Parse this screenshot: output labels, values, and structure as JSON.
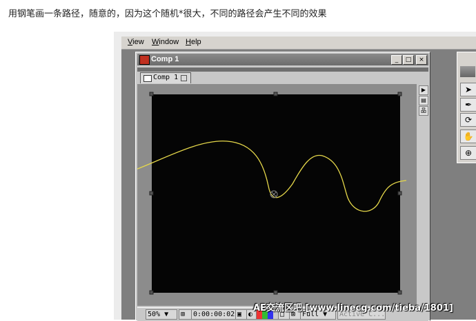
{
  "caption": "用钢笔画一条路径，随意的，因为这个随机*很大，不同的路径会产生不同的效果",
  "menu": {
    "view": "View",
    "window": "Window",
    "help": "Help"
  },
  "window": {
    "title": "Comp 1",
    "minimize": "_",
    "maximize": "□",
    "close": "×"
  },
  "tab": {
    "label": "Comp 1"
  },
  "status": {
    "zoom": "50%",
    "timecode": "0:00:00:02",
    "resolution": "Full",
    "camera": "Active C..."
  },
  "watermark": "AE交流区吧 [www.linecg.com/tieba/1801]",
  "colors": {
    "path": "#e6d84a",
    "canvas": "#050505",
    "pasteboard": "#8c8c8c"
  }
}
